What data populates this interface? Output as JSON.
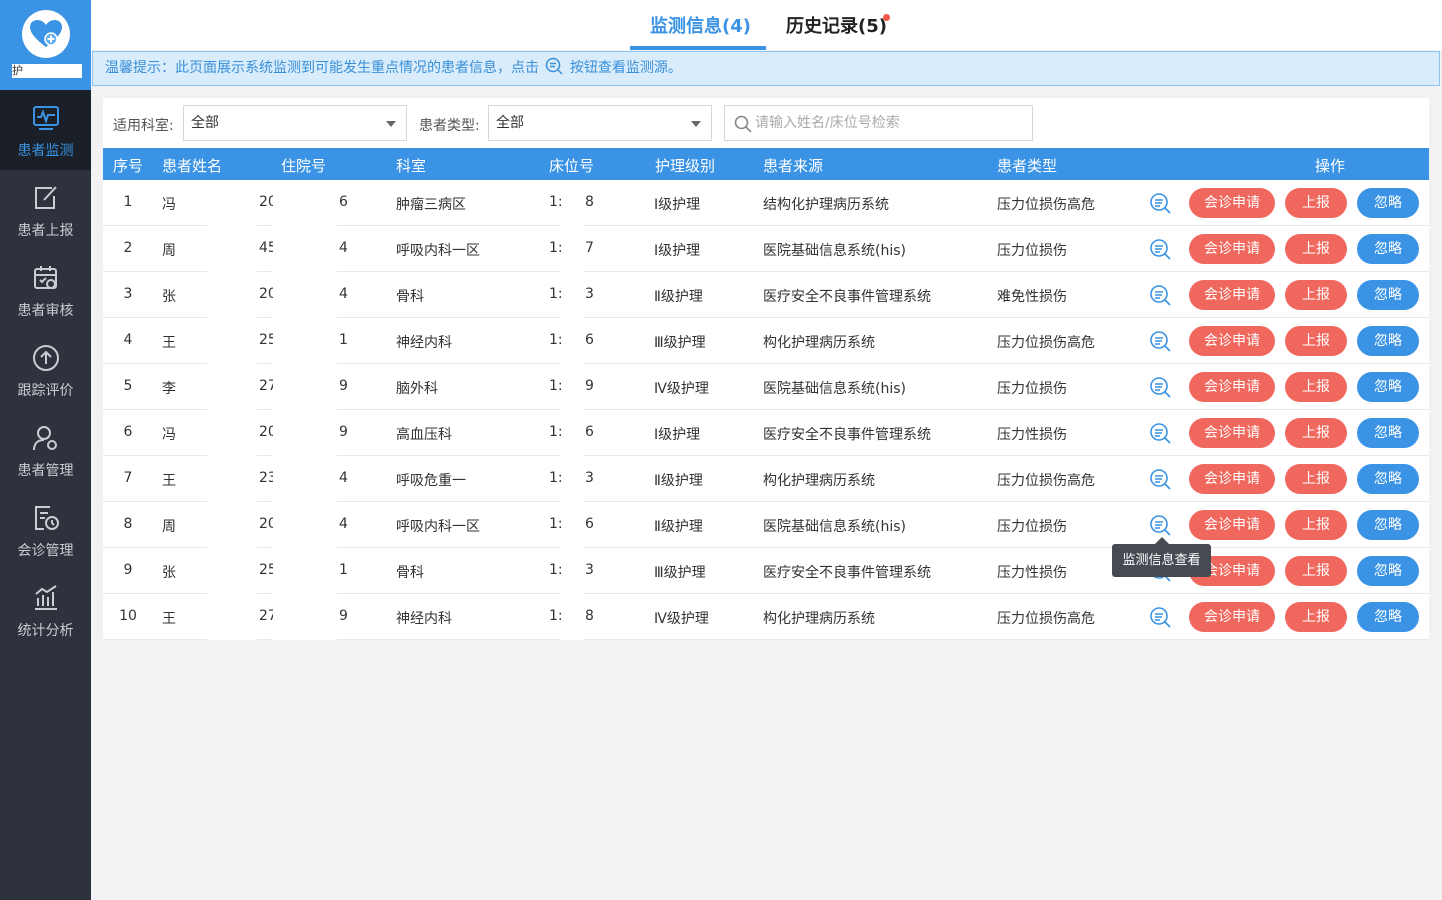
{
  "sidebar": {
    "logo_text": "护",
    "items": [
      {
        "label": "患者监测",
        "icon": "monitor-icon",
        "active": true
      },
      {
        "label": "患者上报",
        "icon": "edit-icon",
        "active": false
      },
      {
        "label": "患者审核",
        "icon": "calendar-check-icon",
        "active": false
      },
      {
        "label": "跟踪评价",
        "icon": "upload-circle-icon",
        "active": false
      },
      {
        "label": "患者管理",
        "icon": "user-gear-icon",
        "active": false
      },
      {
        "label": "会诊管理",
        "icon": "document-clock-icon",
        "active": false
      },
      {
        "label": "统计分析",
        "icon": "bar-chart-icon",
        "active": false
      }
    ]
  },
  "tabs": [
    {
      "label": "监测信息(4)",
      "active": true
    },
    {
      "label": "历史记录(5)",
      "active": false,
      "badge_dot": true
    }
  ],
  "notice": {
    "prefix": "温馨提示：此页面展示系统监测到可能发生重点情况的患者信息，点击",
    "suffix": "按钮查看监测源。"
  },
  "filters": {
    "dept_label": "适用科室:",
    "dept_value": "全部",
    "type_label": "患者类型:",
    "type_value": "全部",
    "search_placeholder": "请输入姓名/床位号检索"
  },
  "table": {
    "headers": [
      "序号",
      "患者姓名",
      "住院号",
      "科室",
      "床位号",
      "护理级别",
      "患者来源",
      "患者类型",
      "操作"
    ],
    "rows": [
      {
        "no": "1",
        "name": "冯",
        "id_a": "20",
        "id_b": "6",
        "dept": "肿瘤三病区",
        "bed_a": "1:",
        "bed_b": "8",
        "level": "Ⅰ级护理",
        "source": "结构化护理病历系统",
        "type": "压力位损伤高危"
      },
      {
        "no": "2",
        "name": "周",
        "id_a": "45",
        "id_b": "4",
        "dept": "呼吸内科一区",
        "bed_a": "1:",
        "bed_b": "7",
        "level": "Ⅰ级护理",
        "source": "医院基础信息系统(his)",
        "type": "压力位损伤"
      },
      {
        "no": "3",
        "name": "张",
        "id_a": "20",
        "id_b": "4",
        "dept": "骨科",
        "bed_a": "1:",
        "bed_b": "3",
        "level": "Ⅱ级护理",
        "source": "医疗安全不良事件管理系统",
        "type": "难免性损伤"
      },
      {
        "no": "4",
        "name": "王",
        "id_a": "25",
        "id_b": "1",
        "dept": "神经内科",
        "bed_a": "1:",
        "bed_b": "6",
        "level": "Ⅲ级护理",
        "source": "构化护理病历系统",
        "type": "压力位损伤高危"
      },
      {
        "no": "5",
        "name": "李",
        "id_a": "27",
        "id_b": "9",
        "dept": "脑外科",
        "bed_a": "1:",
        "bed_b": "9",
        "level": "Ⅳ级护理",
        "source": "医院基础信息系统(his)",
        "type": "压力位损伤"
      },
      {
        "no": "6",
        "name": "冯",
        "id_a": "20",
        "id_b": "9",
        "dept": "高血压科",
        "bed_a": "1:",
        "bed_b": "6",
        "level": "Ⅰ级护理",
        "source": "医疗安全不良事件管理系统",
        "type": "压力性损伤"
      },
      {
        "no": "7",
        "name": "王",
        "id_a": "23",
        "id_b": "4",
        "dept": "呼吸危重一",
        "bed_a": "1:",
        "bed_b": "3",
        "level": "Ⅱ级护理",
        "source": "构化护理病历系统",
        "type": "压力位损伤高危"
      },
      {
        "no": "8",
        "name": "周",
        "id_a": "20",
        "id_b": "4",
        "dept": "呼吸内科一区",
        "bed_a": "1:",
        "bed_b": "6",
        "level": "Ⅱ级护理",
        "source": "医院基础信息系统(his)",
        "type": "压力位损伤"
      },
      {
        "no": "9",
        "name": "张",
        "id_a": "25",
        "id_b": "1",
        "dept": "骨科",
        "bed_a": "1:",
        "bed_b": "3",
        "level": "Ⅲ级护理",
        "source": "医疗安全不良事件管理系统",
        "type": "压力性损伤"
      },
      {
        "no": "10",
        "name": "王",
        "id_a": "27",
        "id_b": "9",
        "dept": "神经内科",
        "bed_a": "1:",
        "bed_b": "8",
        "level": "Ⅳ级护理",
        "source": "构化护理病历系统",
        "type": "压力位损伤高危"
      }
    ],
    "actions": {
      "consult": "会诊申请",
      "report": "上报",
      "ignore": "忽略"
    }
  },
  "tooltip": "监测信息查看",
  "colors": {
    "accent": "#3a93e4",
    "danger": "#f0685d",
    "sidebar": "#2d323c"
  }
}
